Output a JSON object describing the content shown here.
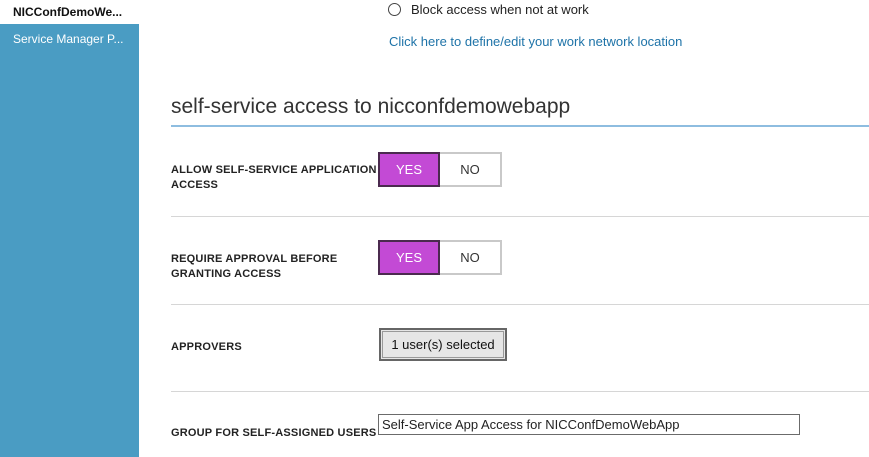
{
  "sidebar": {
    "app_name": "NICConfDemoWe...",
    "items": [
      {
        "label": "Service Manager P..."
      }
    ]
  },
  "access": {
    "block_option": "Block access when not at work",
    "network_link": "Click here to define/edit your work network location"
  },
  "section": {
    "title": "self-service access to nicconfdemowebapp"
  },
  "rows": {
    "allow": {
      "label_line1": "ALLOW SELF-SERVICE APPLICATION",
      "label_line2": "ACCESS",
      "yes": "YES",
      "no": "NO",
      "selected": "YES"
    },
    "approval": {
      "label_line1": "REQUIRE APPROVAL BEFORE",
      "label_line2": "GRANTING ACCESS",
      "yes": "YES",
      "no": "NO",
      "selected": "YES"
    },
    "approvers": {
      "label": "APPROVERS",
      "button": "1 user(s) selected"
    },
    "group": {
      "label": "GROUP FOR SELF-ASSIGNED USERS",
      "value": "Self-Service App Access for NICConfDemoWebApp"
    }
  },
  "colors": {
    "sidebar": "#4a9cc3",
    "toggle_selected": "#c34ad5",
    "link": "#1e73a8",
    "title_rule": "#8ebde0"
  }
}
